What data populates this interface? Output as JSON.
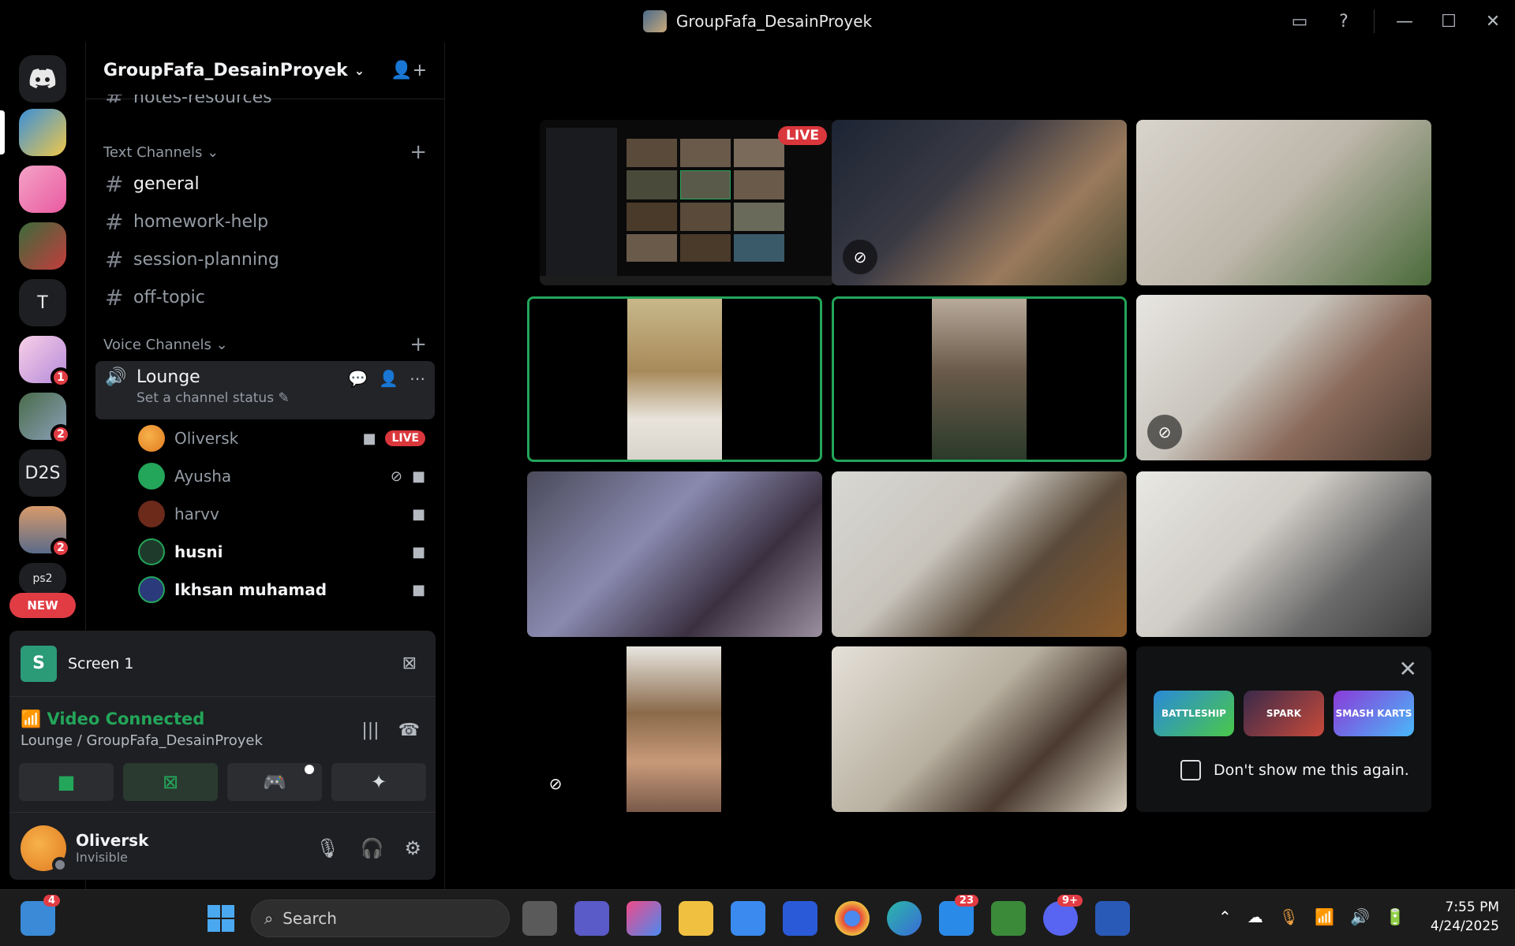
{
  "window": {
    "title": "GroupFafa_DesainProyek"
  },
  "rail": {
    "servers": [
      {
        "label": "T"
      },
      {
        "label": "D2S"
      }
    ],
    "badges": [
      "1",
      "2",
      "2"
    ],
    "new_label": "NEW",
    "partial_label": "ps2"
  },
  "sidebar": {
    "guild_name": "GroupFafa_DesainProyek",
    "partial_channel": "notes-resources",
    "text_category": "Text Channels",
    "text_channels": [
      "general",
      "homework-help",
      "session-planning",
      "off-topic"
    ],
    "voice_category": "Voice Channels",
    "voice_channel": {
      "name": "Lounge",
      "status": "Set a channel status"
    },
    "voice_users": [
      {
        "name": "Oliversk",
        "live": "LIVE"
      },
      {
        "name": "Ayusha"
      },
      {
        "name": "harvv"
      },
      {
        "name": "husni"
      },
      {
        "name": "Ikhsan muhamad"
      }
    ]
  },
  "panel": {
    "screen_label": "Screen 1",
    "screen_icon_letter": "S",
    "connection_status": "Video Connected",
    "connection_location": "Lounge / GroupFafa_DesainProyek",
    "user": {
      "name": "Oliversk",
      "status": "Invisible"
    }
  },
  "grid": {
    "live_label": "LIVE",
    "promo": {
      "games": [
        "BATTLESHIP",
        "SPARK",
        "SMASH KARTS"
      ],
      "dont_show": "Don't show me this again."
    }
  },
  "taskbar": {
    "search_placeholder": "Search",
    "badge_explorer": "4",
    "badge_app": "23",
    "badge_discord": "9+",
    "time": "7:55 PM",
    "date": "4/24/2025"
  },
  "colors": {
    "accent_green": "#23a55a",
    "live_red": "#da373c",
    "badge_red": "#e13c44"
  }
}
